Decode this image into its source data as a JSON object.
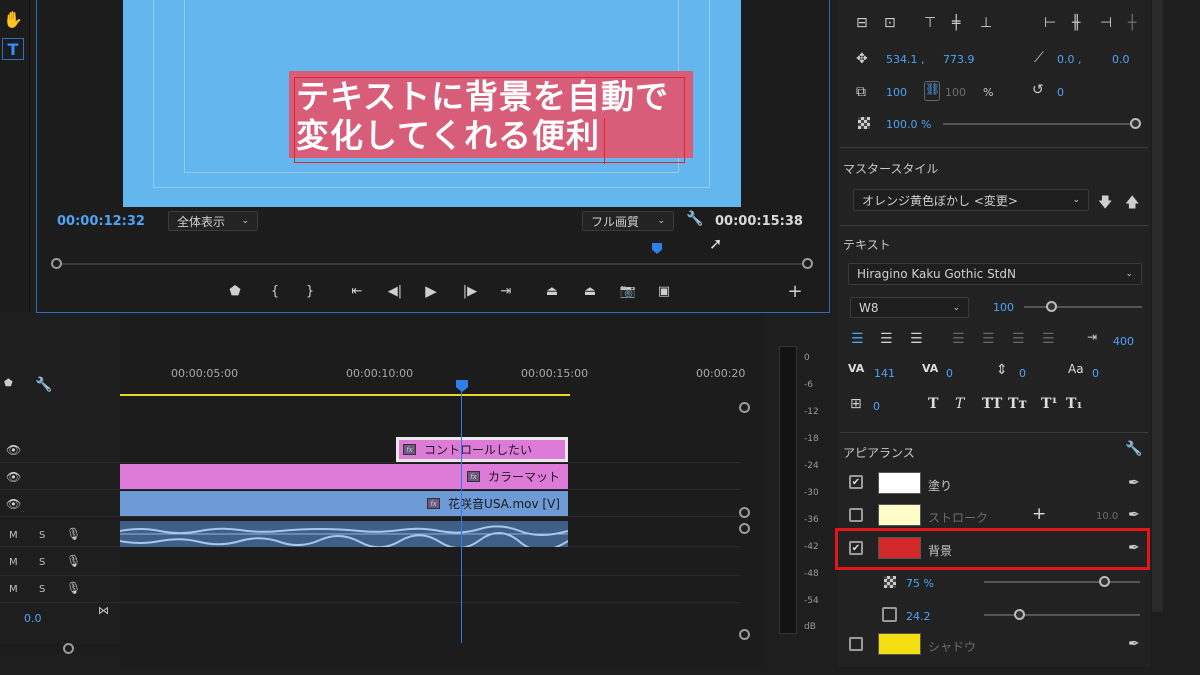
{
  "monitor": {
    "caption_line1": "テキストに背景を自動で",
    "caption_line2": "変化してくれる便利",
    "timecode_current": "00:00:12:32",
    "fit_dropdown": "全体表示",
    "quality_dropdown": "フル画質",
    "timecode_duration": "00:00:15:38"
  },
  "timeline": {
    "ruler": [
      "00:00:05:00",
      "00:00:10:00",
      "00:00:15:00",
      "00:00:20"
    ],
    "clips": {
      "text_clip": "コントロールしたい",
      "color_matte": "カラーマット",
      "video": "花咲音USA.mov [V]"
    },
    "track_controls": [
      "M",
      "S"
    ],
    "volume_value": "0.0"
  },
  "meter": {
    "db_labels": [
      "0",
      "-6",
      "-12",
      "-18",
      "-24",
      "-30",
      "-36",
      "-42",
      "-48",
      "-54",
      "dB"
    ]
  },
  "panel": {
    "position": [
      "534.1 ,",
      "773.9"
    ],
    "anchor": [
      "0.0 ,",
      "0.0"
    ],
    "scale": [
      "100",
      "100",
      "%"
    ],
    "rotation": "0",
    "opacity": "100.0 %",
    "master_style_title": "マスタースタイル",
    "master_style_value": "オレンジ黄色ぼかし <変更>",
    "text_title": "テキスト",
    "font_family": "Hiragino Kaku Gothic StdN",
    "font_weight": "W8",
    "font_size": "100",
    "tracking": "400",
    "kerning": "141",
    "tsume": "0",
    "baseline": "0",
    "leading": "0",
    "tab_value": "0",
    "style_buttons": [
      "T",
      "T",
      "TT",
      "Tт",
      "T¹",
      "T₁"
    ],
    "appearance_title": "アピアランス",
    "fill_label": "塗り",
    "stroke_label": "ストローク",
    "stroke_value": "10.0",
    "background_label": "背景",
    "bg_opacity": "75 %",
    "bg_size": "24.2",
    "shadow_label": "シャドウ"
  },
  "colors": {
    "accent_blue": "#4ea3f5",
    "frame_bg": "#64b6ee",
    "caption_bg": "#dc5a74",
    "highlight_red": "#e3161a",
    "clip_pink": "#de7ad8",
    "clip_blue": "#6e9ad6",
    "fill_swatch": "#ffffff",
    "stroke_swatch": "#fdfcc8",
    "bg_swatch": "#d3292b",
    "shadow_swatch": "#f4df12"
  }
}
